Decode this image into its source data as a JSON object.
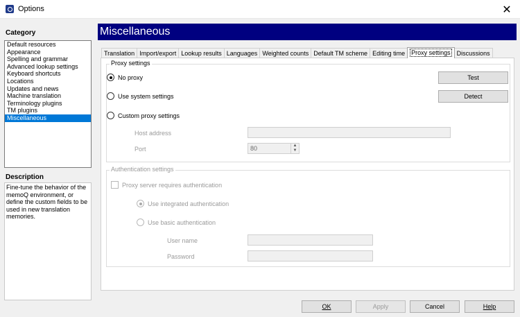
{
  "window": {
    "title": "Options",
    "close_glyph": "✕"
  },
  "category": {
    "heading": "Category",
    "items": [
      "Default resources",
      "Appearance",
      "Spelling and grammar",
      "Advanced lookup settings",
      "Keyboard shortcuts",
      "Locations",
      "Updates and news",
      "Machine translation",
      "Terminology plugins",
      "TM plugins",
      "Miscellaneous"
    ],
    "selected": "Miscellaneous"
  },
  "description": {
    "heading": "Description",
    "text": "Fine-tune the behavior of the memoQ environment, or define the custom fields to be used in new translation memories."
  },
  "panel": {
    "title": "Miscellaneous",
    "tabs": [
      "Translation",
      "Import/export",
      "Lookup results",
      "Languages",
      "Weighted counts",
      "Default TM scheme",
      "Editing time",
      "Proxy settings",
      "Discussions"
    ],
    "active_tab": "Proxy settings"
  },
  "proxy": {
    "group_label": "Proxy settings",
    "no_proxy": "No proxy",
    "use_system": "Use system settings",
    "custom": "Custom proxy settings",
    "selected": "No proxy",
    "host_label": "Host address",
    "host_value": "",
    "port_label": "Port",
    "port_value": "80",
    "test_button": "Test",
    "detect_button": "Detect"
  },
  "auth": {
    "group_label": "Authentication settings",
    "requires_auth": "Proxy server requires authentication",
    "integrated": "Use integrated authentication",
    "basic": "Use basic authentication",
    "username_label": "User name",
    "username_value": "",
    "password_label": "Password",
    "password_value": ""
  },
  "footer": {
    "ok": "OK",
    "apply": "Apply",
    "cancel": "Cancel",
    "help": "Help"
  },
  "colors": {
    "header_bg": "#000080",
    "selection": "#0078d7"
  }
}
